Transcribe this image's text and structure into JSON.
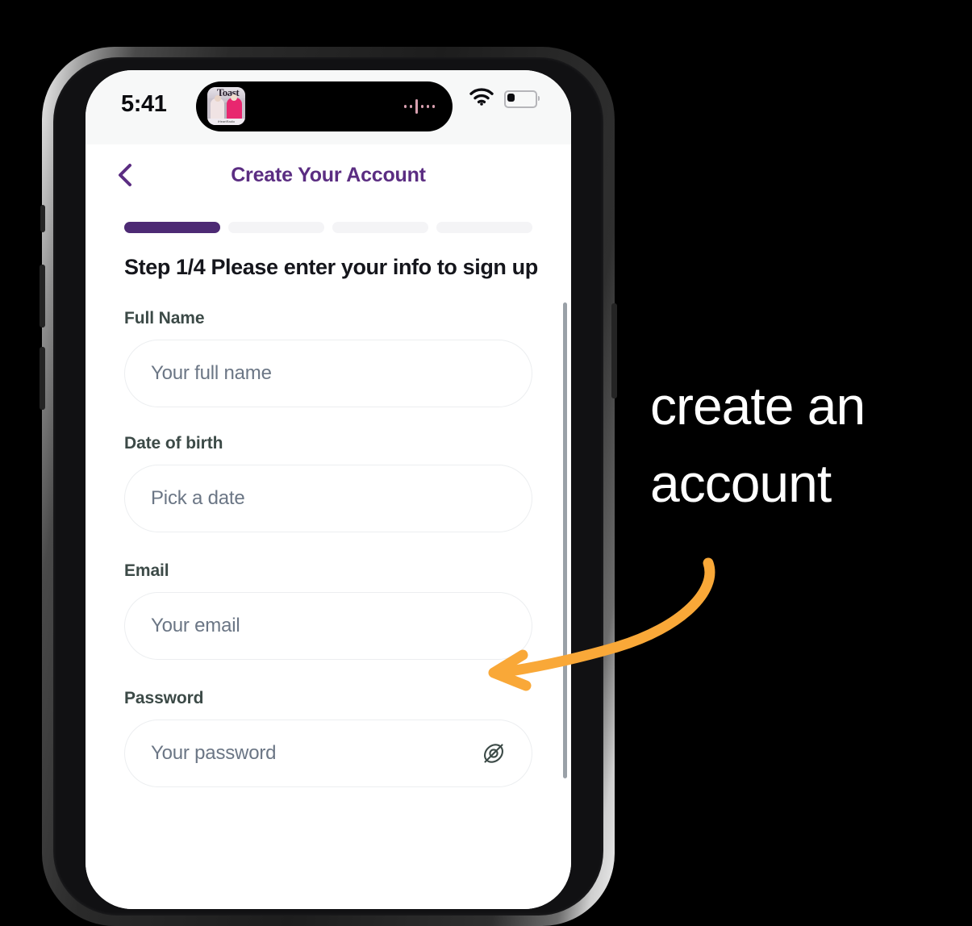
{
  "annotation": {
    "text_line1": "create an",
    "text_line2": "account",
    "arrow_color": "#f9a838",
    "text_color": "#ffffff"
  },
  "device": {
    "frame": "iphone-pro",
    "background": "#000000"
  },
  "status_bar": {
    "time": "5:41",
    "wifi_icon": "wifi-icon",
    "battery_icon": "battery-low-icon",
    "battery_level_percent": 25,
    "dynamic_island": {
      "media_art_title": "Toast",
      "media_art_caption": "iHeartRadio",
      "visualizer_icon": "audio-waveform-icon"
    }
  },
  "nav": {
    "back_icon": "chevron-left-icon",
    "title": "Create Your Account",
    "title_color": "#5b2d82"
  },
  "progress": {
    "current_step": 1,
    "total_steps": 4,
    "active_color": "#4d2a74",
    "inactive_color": "#f4f4f6",
    "segments": [
      {
        "state": "active"
      },
      {
        "state": "inactive"
      },
      {
        "state": "inactive"
      },
      {
        "state": "inactive"
      }
    ]
  },
  "step_heading": "Step 1/4 Please enter your info to sign up",
  "form": {
    "fields": [
      {
        "label": "Full Name",
        "placeholder": "Your full name",
        "value": "",
        "trailing_icon": null
      },
      {
        "label": "Date of birth",
        "placeholder": "Pick a date",
        "value": "",
        "trailing_icon": null
      },
      {
        "label": "Email",
        "placeholder": "Your email",
        "value": "",
        "trailing_icon": null
      },
      {
        "label": "Password",
        "placeholder": "Your password",
        "value": "",
        "trailing_icon": "eye-off-icon"
      }
    ]
  }
}
